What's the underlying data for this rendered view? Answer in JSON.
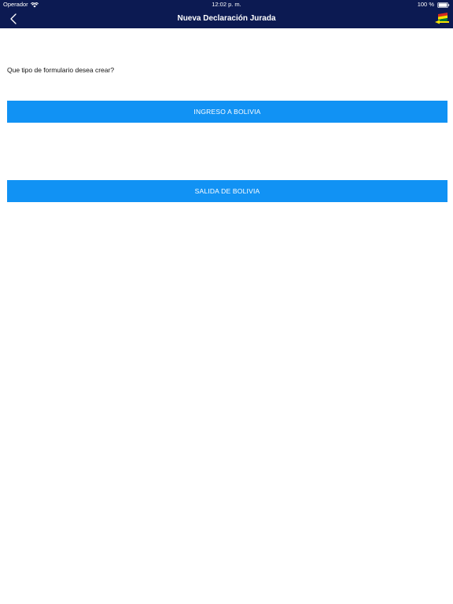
{
  "status_bar": {
    "carrier": "Operador",
    "time": "12:02 p. m.",
    "battery": "100 %",
    "icons": [
      "wifi-icon",
      "battery-icon"
    ]
  },
  "nav": {
    "title": "Nueva Declaración Jurada",
    "back_icon": "chevron-left-icon",
    "flag_icon": "bolivia-flag-arrow-icon"
  },
  "content": {
    "prompt": "Que tipo de formulario desea crear?",
    "buttons": {
      "ingreso": "INGRESO A BOLIVIA",
      "salida": "SALIDA DE BOLIVIA"
    }
  },
  "colors": {
    "header_bg": "#0c1a52",
    "button_bg": "#1192f4",
    "flag_red": "#d52b1e",
    "flag_yellow": "#f9e300",
    "flag_green": "#007934"
  }
}
